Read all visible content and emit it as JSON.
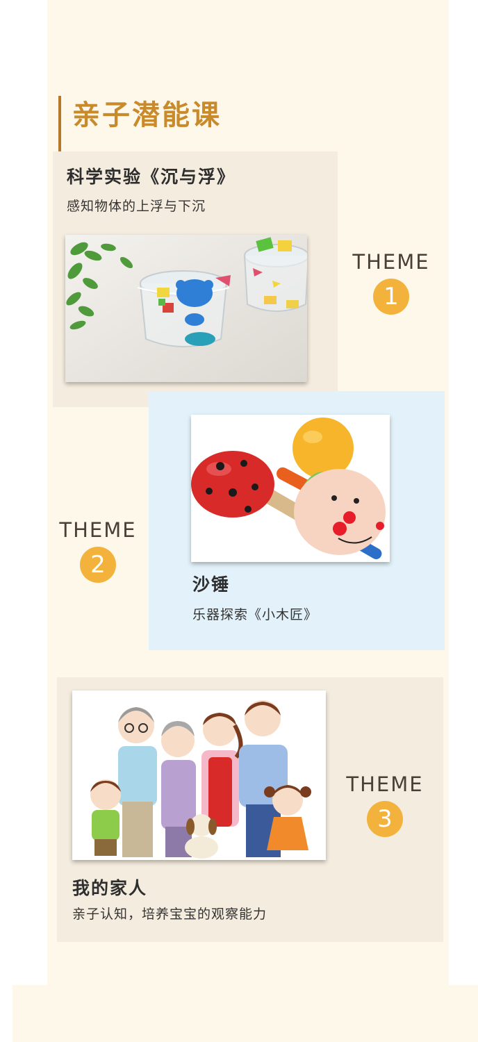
{
  "section": {
    "title": "亲子潜能课"
  },
  "theme_word": "THEME",
  "cards": [
    {
      "title": "科学实验《沉与浮》",
      "subtitle": "感知物体的上浮与下沉",
      "theme_number": "1"
    },
    {
      "title": "沙锤",
      "subtitle": "乐器探索《小木匠》",
      "theme_number": "2"
    },
    {
      "title": "我的家人",
      "subtitle": "亲子认知，培养宝宝的观察能力",
      "theme_number": "3"
    }
  ],
  "colors": {
    "background": "#fdf8ea",
    "card_beige": "#f4ecde",
    "card_blue": "#e3f2fa",
    "title_gold": "#c98a2c",
    "accent_bar": "#b8782a",
    "theme_circle": "#f2b23b"
  }
}
